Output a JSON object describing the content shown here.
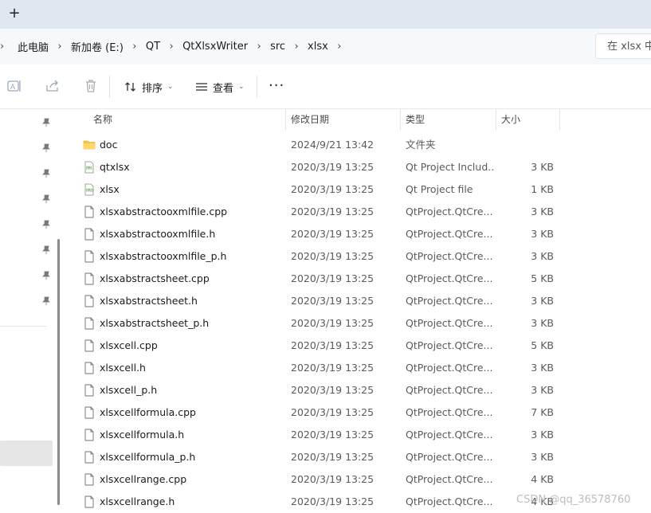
{
  "tabstrip": {
    "new_tab_label": "+"
  },
  "breadcrumb": {
    "items": [
      "此电脑",
      "新加卷 (E:)",
      "QT",
      "QtXlsxWriter",
      "src",
      "xlsx"
    ],
    "separator": "›"
  },
  "search": {
    "placeholder": "在 xlsx 中"
  },
  "toolbar": {
    "sort_label": "排序",
    "view_label": "查看",
    "more_label": "···",
    "icons": [
      "rename-icon",
      "share-icon",
      "delete-icon",
      "sort-icon",
      "view-icon"
    ]
  },
  "columns": {
    "name": "名称",
    "date": "修改日期",
    "type": "类型",
    "size": "大小"
  },
  "files": [
    {
      "icon": "folder-icon",
      "name": "doc",
      "date": "2024/9/21 13:42",
      "type": "文件夹",
      "size": ""
    },
    {
      "icon": "pri-file-icon",
      "name": "qtxlsx",
      "date": "2020/3/19 13:25",
      "type": "Qt Project Includ...",
      "size": "3 KB"
    },
    {
      "icon": "pro-file-icon",
      "name": "xlsx",
      "date": "2020/3/19 13:25",
      "type": "Qt Project file",
      "size": "1 KB"
    },
    {
      "icon": "generic-file-icon",
      "name": "xlsxabstractooxmlfile.cpp",
      "date": "2020/3/19 13:25",
      "type": "QtProject.QtCre...",
      "size": "3 KB"
    },
    {
      "icon": "generic-file-icon",
      "name": "xlsxabstractooxmlfile.h",
      "date": "2020/3/19 13:25",
      "type": "QtProject.QtCre...",
      "size": "3 KB"
    },
    {
      "icon": "generic-file-icon",
      "name": "xlsxabstractooxmlfile_p.h",
      "date": "2020/3/19 13:25",
      "type": "QtProject.QtCre...",
      "size": "3 KB"
    },
    {
      "icon": "generic-file-icon",
      "name": "xlsxabstractsheet.cpp",
      "date": "2020/3/19 13:25",
      "type": "QtProject.QtCre...",
      "size": "5 KB"
    },
    {
      "icon": "generic-file-icon",
      "name": "xlsxabstractsheet.h",
      "date": "2020/3/19 13:25",
      "type": "QtProject.QtCre...",
      "size": "3 KB"
    },
    {
      "icon": "generic-file-icon",
      "name": "xlsxabstractsheet_p.h",
      "date": "2020/3/19 13:25",
      "type": "QtProject.QtCre...",
      "size": "3 KB"
    },
    {
      "icon": "generic-file-icon",
      "name": "xlsxcell.cpp",
      "date": "2020/3/19 13:25",
      "type": "QtProject.QtCre...",
      "size": "5 KB"
    },
    {
      "icon": "generic-file-icon",
      "name": "xlsxcell.h",
      "date": "2020/3/19 13:25",
      "type": "QtProject.QtCre...",
      "size": "3 KB"
    },
    {
      "icon": "generic-file-icon",
      "name": "xlsxcell_p.h",
      "date": "2020/3/19 13:25",
      "type": "QtProject.QtCre...",
      "size": "3 KB"
    },
    {
      "icon": "generic-file-icon",
      "name": "xlsxcellformula.cpp",
      "date": "2020/3/19 13:25",
      "type": "QtProject.QtCre...",
      "size": "7 KB"
    },
    {
      "icon": "generic-file-icon",
      "name": "xlsxcellformula.h",
      "date": "2020/3/19 13:25",
      "type": "QtProject.QtCre...",
      "size": "3 KB"
    },
    {
      "icon": "generic-file-icon",
      "name": "xlsxcellformula_p.h",
      "date": "2020/3/19 13:25",
      "type": "QtProject.QtCre...",
      "size": "3 KB"
    },
    {
      "icon": "generic-file-icon",
      "name": "xlsxcellrange.cpp",
      "date": "2020/3/19 13:25",
      "type": "QtProject.QtCre...",
      "size": "4 KB"
    },
    {
      "icon": "generic-file-icon",
      "name": "xlsxcellrange.h",
      "date": "2020/3/19 13:25",
      "type": "QtProject.QtCre...",
      "size": "4 KB"
    }
  ],
  "watermark": "CSDN @qq_36578760",
  "colors": {
    "tabstrip_bg": "#dfe7f1",
    "addressbar_bg": "#f6f9fc",
    "folder": "#f5c242",
    "selection": "#e6e6e6"
  }
}
